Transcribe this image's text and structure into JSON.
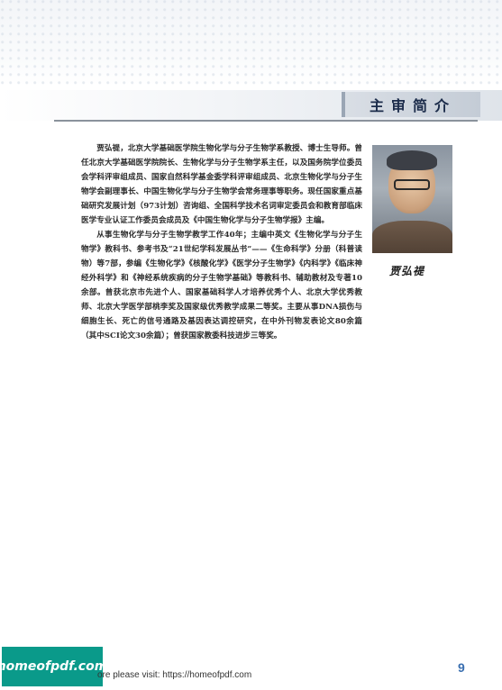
{
  "header": {
    "title": "主审简介"
  },
  "bio": {
    "paragraphs": [
      "贾弘禔，北京大学基础医学院生物化学与分子生物学系教授、博士生导师。曾任北京大学基础医学院院长、生物化学与分子生物学系主任，以及国务院学位委员会学科评审组成员、国家自然科学基金委学科评审组成员、北京生物化学与分子生物学会副理事长、中国生物化学与分子生物学会常务理事等职务。现任国家重点基础研究发展计划（973计划）咨询组、全国科学技术名词审定委员会和教育部临床医学专业认证工作委员会成员及《中国生物化学与分子生物学报》主编。",
      "从事生物化学与分子生物学教学工作40年；主编中英文《生物化学与分子生物学》教科书、参考书及“21世纪学科发展丛书”——《生命科学》分册（科普读物）等7部，参编《生物化学》《核酸化学》《医学分子生物学》《内科学》《临床神经外科学》和《神经系统疾病的分子生物学基础》等教科书、辅助教材及专著10余部。曾获北京市先进个人、国家基础科学人才培养优秀个人、北京大学优秀教师、北京大学医学部桃李奖及国家级优秀教学成果二等奖。主要从事DNA损伤与细胞生长、死亡的信号通路及基因表达调控研究，在中外刊物发表论文80余篇（其中SCI论文30余篇）；曾获国家教委科技进步三等奖。"
    ]
  },
  "portrait": {
    "signature": "贾弘禔"
  },
  "footer": {
    "page_number": "9",
    "note": "ore please visit: https://homeofpdf.com",
    "logo_text": "homeofpdf.com"
  }
}
